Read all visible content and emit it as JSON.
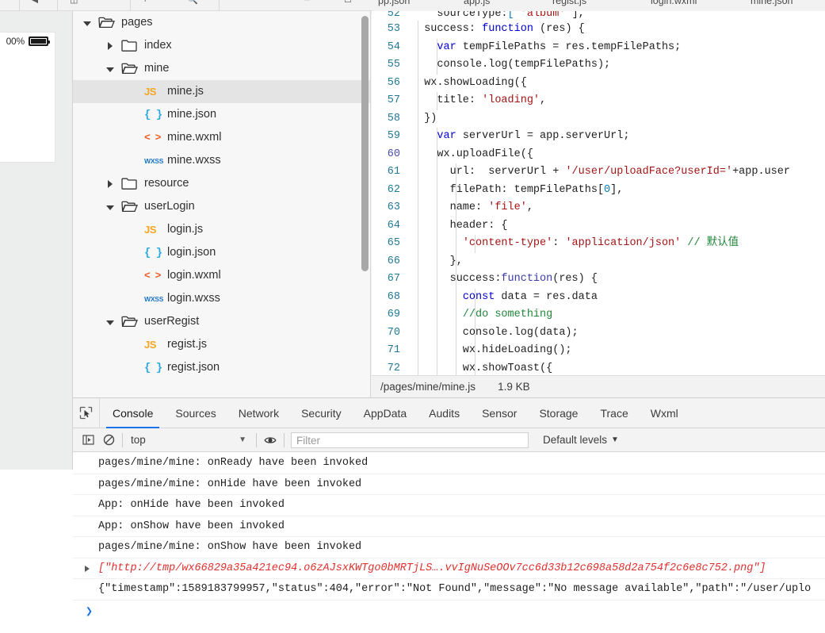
{
  "simulator": {
    "battery_percent": "00%",
    "home_icon": "home-button-icon"
  },
  "editor_tabs": [
    {
      "label": "pp.json",
      "active": false
    },
    {
      "label": "app.js",
      "active": false
    },
    {
      "label": "regist.js",
      "active": false
    },
    {
      "label": "login.wxml",
      "active": false
    },
    {
      "label": "mine.json",
      "active": false
    }
  ],
  "file_tree": [
    {
      "label": "pages",
      "indent": 0,
      "caret": "down",
      "icon": "folder-open",
      "selected": false
    },
    {
      "label": "index",
      "indent": 1,
      "caret": "right",
      "icon": "folder-closed",
      "selected": false
    },
    {
      "label": "mine",
      "indent": 1,
      "caret": "down",
      "icon": "folder-open",
      "selected": false
    },
    {
      "label": "mine.js",
      "indent": 2,
      "caret": "none",
      "icon": "js",
      "selected": true
    },
    {
      "label": "mine.json",
      "indent": 2,
      "caret": "none",
      "icon": "json",
      "selected": false
    },
    {
      "label": "mine.wxml",
      "indent": 2,
      "caret": "none",
      "icon": "wxml",
      "selected": false
    },
    {
      "label": "mine.wxss",
      "indent": 2,
      "caret": "none",
      "icon": "wxss",
      "selected": false
    },
    {
      "label": "resource",
      "indent": 1,
      "caret": "right",
      "icon": "folder-closed",
      "selected": false
    },
    {
      "label": "userLogin",
      "indent": 1,
      "caret": "down",
      "icon": "folder-open",
      "selected": false
    },
    {
      "label": "login.js",
      "indent": 2,
      "caret": "none",
      "icon": "js",
      "selected": false
    },
    {
      "label": "login.json",
      "indent": 2,
      "caret": "none",
      "icon": "json",
      "selected": false
    },
    {
      "label": "login.wxml",
      "indent": 2,
      "caret": "none",
      "icon": "wxml",
      "selected": false
    },
    {
      "label": "login.wxss",
      "indent": 2,
      "caret": "none",
      "icon": "wxss",
      "selected": false
    },
    {
      "label": "userRegist",
      "indent": 1,
      "caret": "down",
      "icon": "folder-open",
      "selected": false
    },
    {
      "label": "regist.js",
      "indent": 2,
      "caret": "none",
      "icon": "js",
      "selected": false
    },
    {
      "label": "regist.json",
      "indent": 2,
      "caret": "none",
      "icon": "json",
      "selected": false
    }
  ],
  "code": [
    {
      "num": "52",
      "indents": 0,
      "highlight": false,
      "clipped": true,
      "tokens": [
        {
          "t": "    sourceType:",
          "c": ""
        },
        {
          "t": "[",
          "c": "num"
        },
        {
          "t": " 'album' ",
          "c": "str"
        },
        {
          "t": "],",
          "c": ""
        }
      ]
    },
    {
      "num": "53",
      "indents": 1,
      "highlight": false,
      "tokens": [
        {
          "t": "  success: ",
          "c": ""
        },
        {
          "t": "function",
          "c": "kw"
        },
        {
          "t": " (res) {",
          "c": ""
        }
      ]
    },
    {
      "num": "54",
      "indents": 2,
      "highlight": false,
      "tokens": [
        {
          "t": "    ",
          "c": ""
        },
        {
          "t": "var",
          "c": "kw"
        },
        {
          "t": " tempFilePaths = res.tempFilePaths;",
          "c": ""
        }
      ]
    },
    {
      "num": "55",
      "indents": 2,
      "highlight": false,
      "tokens": [
        {
          "t": "    console.log(tempFilePaths);",
          "c": ""
        }
      ]
    },
    {
      "num": "56",
      "indents": 1,
      "highlight": false,
      "tokens": [
        {
          "t": "  wx.showLoading({",
          "c": ""
        }
      ]
    },
    {
      "num": "57",
      "indents": 2,
      "highlight": false,
      "tokens": [
        {
          "t": "    title: ",
          "c": ""
        },
        {
          "t": "'loading'",
          "c": "str"
        },
        {
          "t": ",",
          "c": ""
        }
      ]
    },
    {
      "num": "58",
      "indents": 1,
      "highlight": false,
      "tokens": [
        {
          "t": "  })",
          "c": ""
        }
      ]
    },
    {
      "num": "59",
      "indents": 2,
      "highlight": false,
      "tokens": [
        {
          "t": "    ",
          "c": ""
        },
        {
          "t": "var",
          "c": "kw"
        },
        {
          "t": " serverUrl = app.serverUrl;",
          "c": ""
        }
      ]
    },
    {
      "num": "60",
      "indents": 2,
      "highlight": true,
      "tokens": [
        {
          "t": "    wx.uploadFile({",
          "c": ""
        }
      ]
    },
    {
      "num": "61",
      "indents": 3,
      "highlight": false,
      "tokens": [
        {
          "t": "      url:  serverUrl + ",
          "c": ""
        },
        {
          "t": "'/user/uploadFace?userId='",
          "c": "str"
        },
        {
          "t": "+app.user",
          "c": ""
        }
      ]
    },
    {
      "num": "62",
      "indents": 3,
      "highlight": false,
      "tokens": [
        {
          "t": "      filePath: tempFilePaths[",
          "c": ""
        },
        {
          "t": "0",
          "c": "num"
        },
        {
          "t": "],",
          "c": ""
        }
      ]
    },
    {
      "num": "63",
      "indents": 3,
      "highlight": false,
      "tokens": [
        {
          "t": "      name: ",
          "c": ""
        },
        {
          "t": "'file'",
          "c": "str"
        },
        {
          "t": ",",
          "c": ""
        }
      ]
    },
    {
      "num": "64",
      "indents": 3,
      "highlight": false,
      "tokens": [
        {
          "t": "      header: {",
          "c": ""
        }
      ]
    },
    {
      "num": "65",
      "indents": 4,
      "highlight": false,
      "tokens": [
        {
          "t": "        ",
          "c": ""
        },
        {
          "t": "'content-type'",
          "c": "str"
        },
        {
          "t": ": ",
          "c": ""
        },
        {
          "t": "'application/json'",
          "c": "str"
        },
        {
          "t": " ",
          "c": ""
        },
        {
          "t": "// 默认值",
          "c": "cmt"
        }
      ]
    },
    {
      "num": "66",
      "indents": 3,
      "highlight": false,
      "tokens": [
        {
          "t": "      },",
          "c": ""
        }
      ]
    },
    {
      "num": "67",
      "indents": 3,
      "highlight": false,
      "tokens": [
        {
          "t": "      success:",
          "c": ""
        },
        {
          "t": "function",
          "c": "fn"
        },
        {
          "t": "(res) {",
          "c": ""
        }
      ]
    },
    {
      "num": "68",
      "indents": 4,
      "highlight": false,
      "tokens": [
        {
          "t": "        ",
          "c": ""
        },
        {
          "t": "const",
          "c": "kw"
        },
        {
          "t": " data = res.data",
          "c": ""
        }
      ]
    },
    {
      "num": "69",
      "indents": 4,
      "highlight": false,
      "tokens": [
        {
          "t": "        ",
          "c": ""
        },
        {
          "t": "//do something",
          "c": "cmt"
        }
      ]
    },
    {
      "num": "70",
      "indents": 4,
      "highlight": false,
      "tokens": [
        {
          "t": "        console.log(data);",
          "c": ""
        }
      ]
    },
    {
      "num": "71",
      "indents": 4,
      "highlight": false,
      "tokens": [
        {
          "t": "        wx.hideLoading();",
          "c": ""
        }
      ]
    },
    {
      "num": "72",
      "indents": 4,
      "highlight": false,
      "tokens": [
        {
          "t": "        wx.showToast({",
          "c": ""
        }
      ]
    }
  ],
  "status_bar": {
    "path": "/pages/mine/mine.js",
    "size": "1.9 KB"
  },
  "devtools": {
    "inspect_icon": "inspect-element-icon",
    "tabs": [
      {
        "label": "Console",
        "active": true
      },
      {
        "label": "Sources",
        "active": false
      },
      {
        "label": "Network",
        "active": false
      },
      {
        "label": "Security",
        "active": false
      },
      {
        "label": "AppData",
        "active": false
      },
      {
        "label": "Audits",
        "active": false
      },
      {
        "label": "Sensor",
        "active": false
      },
      {
        "label": "Storage",
        "active": false
      },
      {
        "label": "Trace",
        "active": false
      },
      {
        "label": "Wxml",
        "active": false
      }
    ],
    "filter_bar": {
      "sidebar_icon": "console-sidebar-icon",
      "clear_icon": "clear-console-icon",
      "context": "top",
      "context_caret": "▼",
      "eye_icon": "live-expression-eye-icon",
      "filter_placeholder": "Filter",
      "filter_value": "",
      "levels_label": "Default levels",
      "levels_caret": "▼"
    },
    "console_rows": [
      {
        "text": "pages/mine/mine: onReady have been invoked",
        "kind": "log",
        "expandable": false
      },
      {
        "text": "pages/mine/mine: onHide have been invoked",
        "kind": "log",
        "expandable": false
      },
      {
        "text": "App: onHide have been invoked",
        "kind": "log",
        "expandable": false
      },
      {
        "text": "App: onShow have been invoked",
        "kind": "log",
        "expandable": false
      },
      {
        "text": "pages/mine/mine: onShow have been invoked",
        "kind": "log",
        "expandable": false
      },
      {
        "text": "[\"http://tmp/wx66829a35a421ec94.o6zAJsxKWTgo0bMRTjLS….vvIgNuSeOOv7cc6d33b12c698a58d2a754f2c6e8c752.png\"]",
        "kind": "error",
        "expandable": true
      },
      {
        "text": "{\"timestamp\":1589183799957,\"status\":404,\"error\":\"Not Found\",\"message\":\"No message available\",\"path\":\"/user/uplo",
        "kind": "log",
        "expandable": false
      }
    ],
    "prompt_symbol": "❯"
  },
  "colors": {
    "accent_blue": "#1a73e8",
    "error_red": "#e03030",
    "js_yellow": "#f5a623",
    "json_blue": "#29a8e0",
    "wxml_orange": "#f05a28",
    "wxss_blue": "#1a73c4",
    "linenum_blue": "#237893"
  }
}
